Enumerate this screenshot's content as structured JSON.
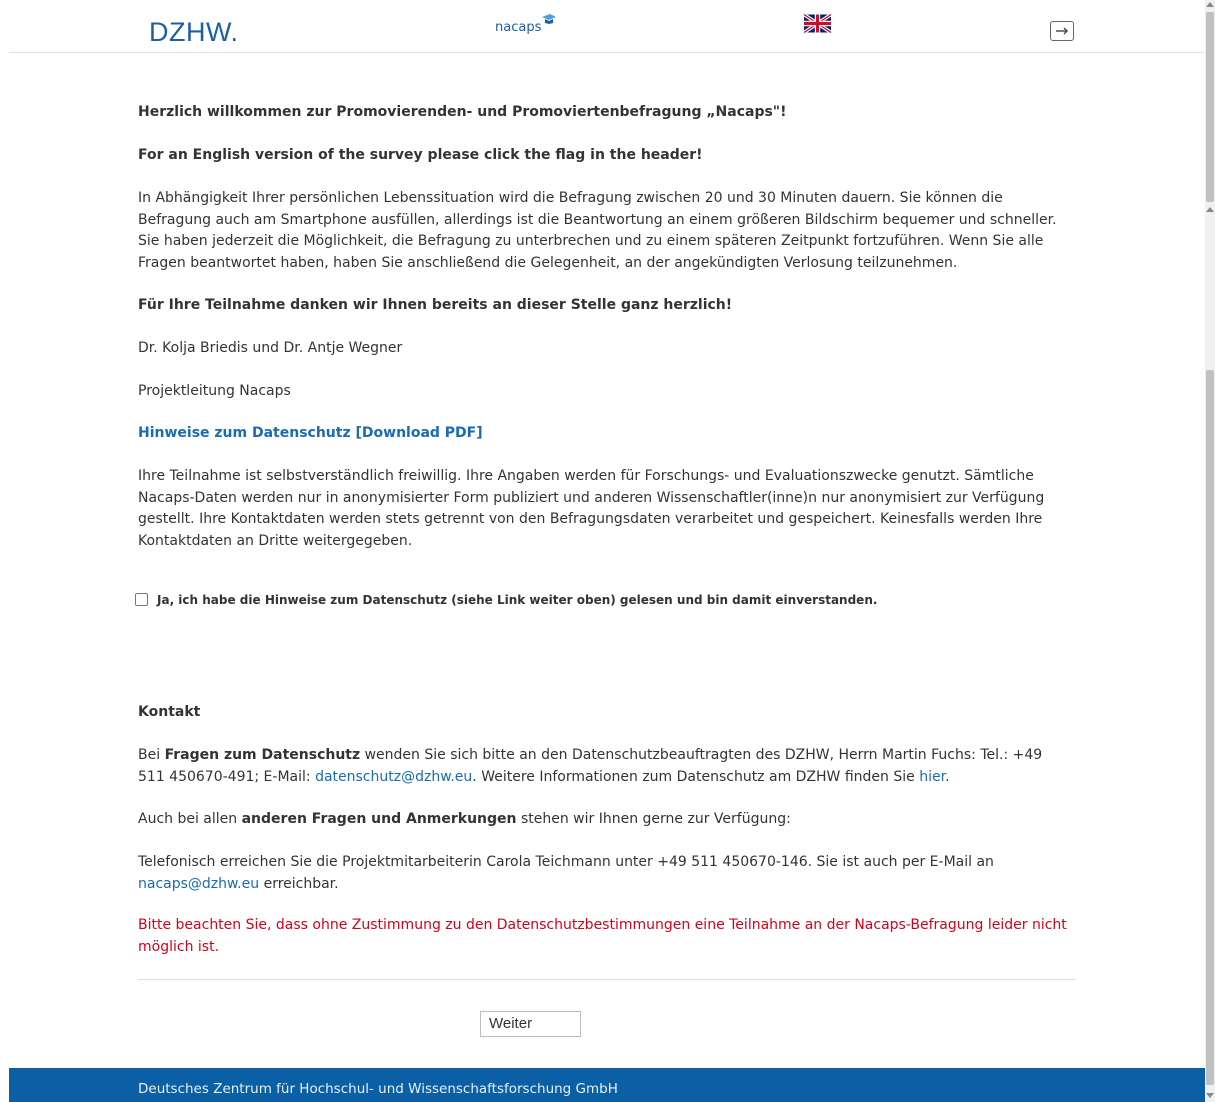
{
  "header": {
    "logo_left": "DZHW.",
    "logo_center": "nacaps",
    "flag_icon": "uk-flag-icon",
    "logout_icon": "logout-icon"
  },
  "content": {
    "title": "Herzlich willkommen zur Promovierenden- und Promoviertenbefragung „Nacaps\"!",
    "english_notice": "For an English version of the survey please click the flag in the header!",
    "intro": "In Abhängigkeit Ihrer persönlichen Lebenssituation wird die Befragung zwischen 20 und 30 Minuten dauern. Sie können die Befragung auch am Smartphone ausfüllen, allerdings ist die Beantwortung an einem größeren Bildschirm bequemer und schneller. Sie haben jederzeit die Möglichkeit, die Befragung zu unterbrechen und zu einem späteren Zeitpunkt fortzuführen. Wenn Sie alle Fragen beantwortet haben, haben Sie anschließend die Gelegenheit, an der angekündigten Verlosung teilzunehmen.",
    "thanks": "Für Ihre Teilnahme danken wir Ihnen bereits an dieser Stelle ganz herzlich!",
    "names": "Dr. Kolja Briedis und Dr. Antje Wegner",
    "lead": "Projektleitung Nacaps",
    "pdf_link": "Hinweise zum Datenschutz [Download PDF]",
    "voluntary": "Ihre Teilnahme ist selbstverständlich freiwillig. Ihre Angaben werden für Forschungs- und Evaluationszwecke genutzt. Sämtliche Nacaps-Daten werden nur in anonymisierter Form publiziert und anderen Wissenschaftler(inne)n nur anonymisiert zur Verfügung gestellt. Ihre Kontaktdaten werden stets getrennt von den Befragungsdaten verarbeitet und gespeichert. Keinesfalls werden Ihre Kontaktdaten an Dritte weitergegeben."
  },
  "consent": {
    "label": "Ja, ich habe die Hinweise zum Datenschutz (siehe Link weiter oben) gelesen und bin damit einverstanden.",
    "checked": false
  },
  "contact": {
    "heading": "Kontakt",
    "ds_prefix": "Bei ",
    "ds_bold": "Fragen zum Datenschutz",
    "ds_text": " wenden Sie sich bitte an den Datenschutzbeauftragten des DZHW, Herrn Martin Fuchs: Tel.: +49 511 450670-491; E-Mail: ",
    "ds_email": "datenschutz@dzhw.eu",
    "ds_text2": ". Weitere Informationen zum Datenschutz am DZHW finden Sie ",
    "ds_link": "hier",
    "ds_end": ".",
    "other_prefix": "Auch bei allen ",
    "other_bold": "anderen Fragen und Anmerkungen",
    "other_text": " stehen wir Ihnen gerne zur Verfügung:",
    "phone_text": "Telefonisch erreichen Sie die Projektmitarbeiterin Carola Teichmann unter +49 511 450670-146. Sie ist auch per E-Mail an ",
    "phone_email": "nacaps@dzhw.eu",
    "phone_end": " erreichbar.",
    "warning": "Bitte beachten Sie, dass ohne Zustimmung zu den Datenschutzbestimmungen eine Teilnahme an der Nacaps-Befragung leider nicht möglich ist."
  },
  "actions": {
    "next_label": "Weiter"
  },
  "footer": {
    "text": "Deutsches Zentrum für Hochschul- und Wissenschaftsforschung GmbH"
  },
  "colors": {
    "brand_blue": "#1d5fa6",
    "link": "#1a6bb5",
    "warning_red": "#d0021b",
    "footer_bg": "#0b5fa5"
  }
}
